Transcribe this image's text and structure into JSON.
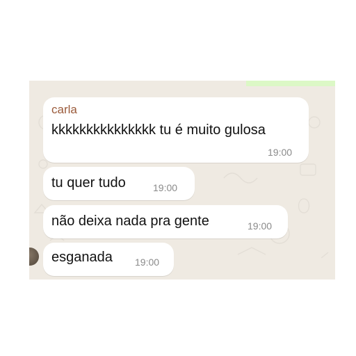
{
  "chat": {
    "messages": [
      {
        "sender": "carla",
        "text": "kkkkkkkkkkkkkkk tu é muito gulosa",
        "time": "19:00"
      },
      {
        "text": "tu quer tudo",
        "time": "19:00"
      },
      {
        "text": "não deixa nada pra gente",
        "time": "19:00"
      },
      {
        "text": "esganada",
        "time": "19:00"
      }
    ]
  },
  "colors": {
    "background": "#efeae2",
    "bubble": "#ffffff",
    "sender_name": "#9a5a3a",
    "timestamp": "#8a8a8a"
  }
}
